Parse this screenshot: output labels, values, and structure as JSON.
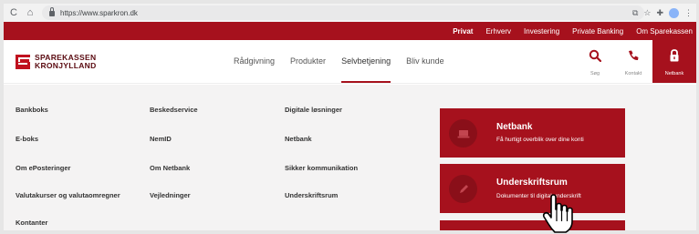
{
  "browser": {
    "url": "https://www.sparkron.dk",
    "back_glyph": "C",
    "home_glyph": "⌂"
  },
  "topnav": {
    "items": [
      "Privat",
      "Erhverv",
      "Investering",
      "Private Banking",
      "Om Sparekassen"
    ]
  },
  "logo": {
    "line1": "SPAREKASSEN",
    "line2": "KRONJYLLAND"
  },
  "mainnav": {
    "items": [
      "Rådgivning",
      "Produkter",
      "Selvbetjening",
      "Bliv kunde"
    ]
  },
  "header_buttons": {
    "search_label": "Søg",
    "contact_label": "Kontakt",
    "netbank_label": "Netbank"
  },
  "dropdown": {
    "col1": [
      "Bankboks",
      "E-boks",
      "Om ePosteringer",
      "Valutakurser og valutaomregner",
      "Kontanter"
    ],
    "col2": [
      "Beskedservice",
      "NemID",
      "Om Netbank",
      "Vejledninger"
    ],
    "col3": [
      "Digitale løsninger",
      "Netbank",
      "Sikker kommunikation",
      "Underskriftsrum"
    ]
  },
  "cards": [
    {
      "title": "Netbank",
      "subtitle": "Få hurtigt overblik over dine konti"
    },
    {
      "title": "Underskriftsrum",
      "subtitle": "Dokumenter til digital underskrift"
    }
  ],
  "colors": {
    "brand_red": "#a6111d",
    "card_circle": "#8a0f19",
    "dropdown_bg": "#f4f3f3"
  }
}
